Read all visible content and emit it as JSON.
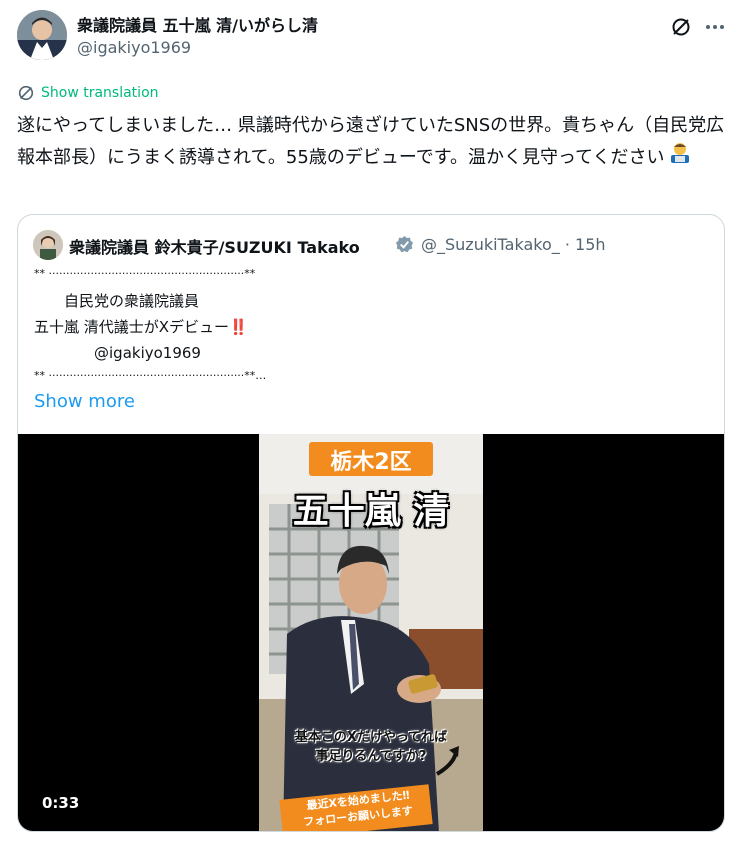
{
  "tweet": {
    "author_name": "衆議院議員 五十嵐 清/いがらし清",
    "author_handle": "@igakiyo1969",
    "translate_label": "Show translation",
    "text": "遂にやってしまいました… 県議時代から遠ざけていたSNSの世界。貴ちゃん（自民党広報本部長）にうまく誘導されて。55歳のデビューです。温かく見守ってください"
  },
  "quote": {
    "author_name": "衆議院議員 鈴木貴子/SUZUKI Takako",
    "author_handle": "@_SuzukiTakako_",
    "time": "· 15h",
    "lines": [
      "** ························································**",
      "　　自民党の衆議院議員",
      "五十嵐 清代議士がXデビュー‼️",
      "　　　　@igakiyo1969",
      "** ························································**…"
    ],
    "show_more": "Show more"
  },
  "video": {
    "district": "栃木2区",
    "name": "五十嵐 清",
    "caption1": "基本このXだけやってれば",
    "caption2": "事足りるんですか?",
    "banner1": "最近Xを始めました‼",
    "banner2": "フォローお願いします",
    "timestamp": "0:33"
  },
  "icons": {
    "grok": "grok-icon",
    "more": "more-icon",
    "translate": "translate-icon",
    "verified": "verified-badge-icon"
  },
  "colors": {
    "accent": "#1d9bf0",
    "translate": "#00ba7c",
    "orange": "#f28c1e"
  }
}
